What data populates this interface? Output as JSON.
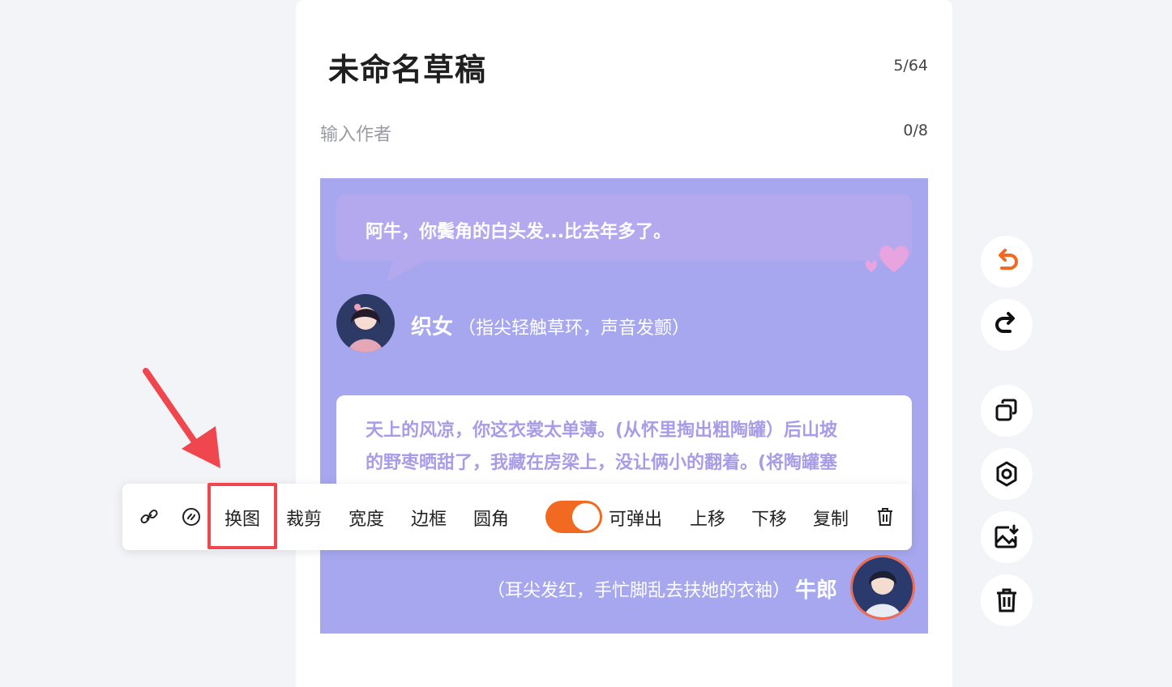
{
  "editor": {
    "title": "未命名草稿",
    "title_count": "5/64",
    "author_placeholder": "输入作者",
    "author_count": "0/8"
  },
  "card": {
    "bubble1_text": "阿牛，你鬓角的白头发...比去年多了。",
    "speaker1_name": "织女",
    "speaker1_stage": "（指尖轻触草环，声音发颤）",
    "bubble2_line1": "天上的风凉，你这衣裳太单薄。(从怀里掏出粗陶罐）后山坡",
    "bubble2_line2": "的野枣晒甜了，我藏在房梁上，没让俩小的翻着。(将陶罐塞",
    "speaker2_stage": "（耳尖发红，手忙脚乱去扶她的衣袖）",
    "speaker2_name": "牛郎",
    "colors": {
      "background": "#a6a7ee",
      "bubble": "#b4a8ee",
      "avatar_border": "#ef6a52"
    }
  },
  "toolbar": {
    "link_icon": "link-icon",
    "miniprogram_icon": "mini-program-icon",
    "replace": "换图",
    "crop": "裁剪",
    "width": "宽度",
    "border": "边框",
    "radius": "圆角",
    "popup_toggle_on": true,
    "popup_label": "可弹出",
    "move_up": "上移",
    "move_down": "下移",
    "copy": "复制",
    "delete_icon": "trash-icon",
    "toggle_color": "#f26a22"
  },
  "sidebar": {
    "buttons": [
      "undo-icon",
      "redo-icon",
      "copy-icon",
      "settings-icon",
      "save-image-icon",
      "trash-icon"
    ]
  },
  "annotation": {
    "highlight_color": "#f0464e"
  }
}
